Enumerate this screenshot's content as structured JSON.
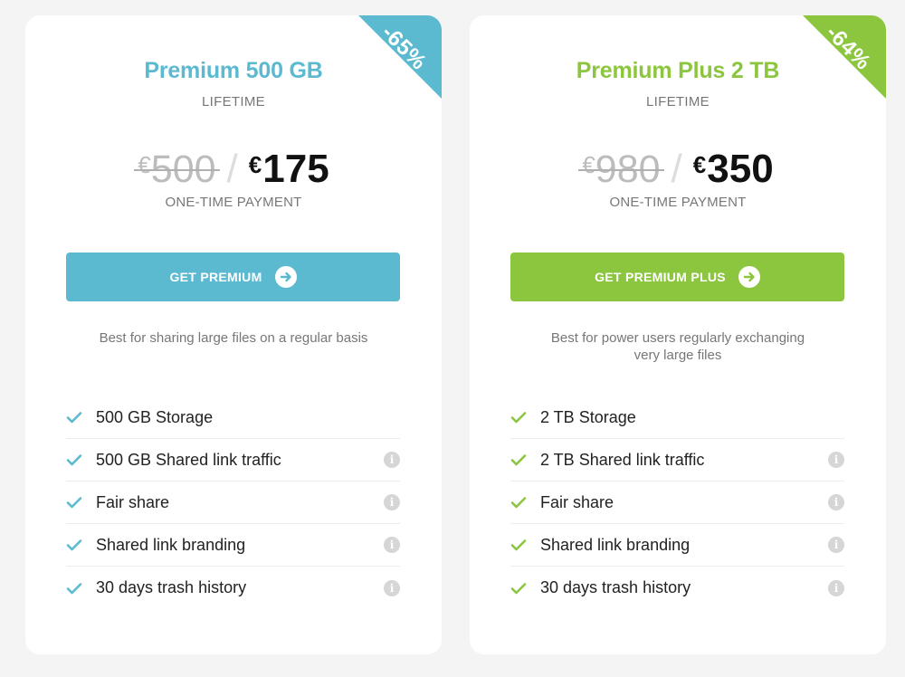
{
  "plans": [
    {
      "title": "Premium 500 GB",
      "period": "LIFETIME",
      "discount": "-65%",
      "old_currency": "€",
      "old_price": "500",
      "slash": "/",
      "new_currency": "€",
      "new_price": "175",
      "payment_note": "ONE-TIME PAYMENT",
      "cta_label": "GET PREMIUM",
      "cta_icon": "arrow-right-circle-icon",
      "description": "Best for sharing large files on a regular basis",
      "accent": "#5bbad0",
      "features": [
        {
          "label": "500 GB Storage",
          "info": false
        },
        {
          "label": "500 GB Shared link traffic",
          "info": true
        },
        {
          "label": "Fair share",
          "info": true
        },
        {
          "label": "Shared link branding",
          "info": true
        },
        {
          "label": "30 days trash history",
          "info": true
        }
      ]
    },
    {
      "title": "Premium Plus 2 TB",
      "period": "LIFETIME",
      "discount": "-64%",
      "old_currency": "€",
      "old_price": "980",
      "slash": "/",
      "new_currency": "€",
      "new_price": "350",
      "payment_note": "ONE-TIME PAYMENT",
      "cta_label": "GET PREMIUM PLUS",
      "cta_icon": "arrow-right-circle-icon",
      "description": "Best for power users regularly exchanging very large files",
      "accent": "#8cc63f",
      "features": [
        {
          "label": "2 TB Storage",
          "info": false
        },
        {
          "label": "2 TB Shared link traffic",
          "info": true
        },
        {
          "label": "Fair share",
          "info": true
        },
        {
          "label": "Shared link branding",
          "info": true
        },
        {
          "label": "30 days trash history",
          "info": true
        }
      ]
    }
  ],
  "info_icon": "info-icon",
  "info_glyph": "i",
  "check_icon": "check-icon"
}
